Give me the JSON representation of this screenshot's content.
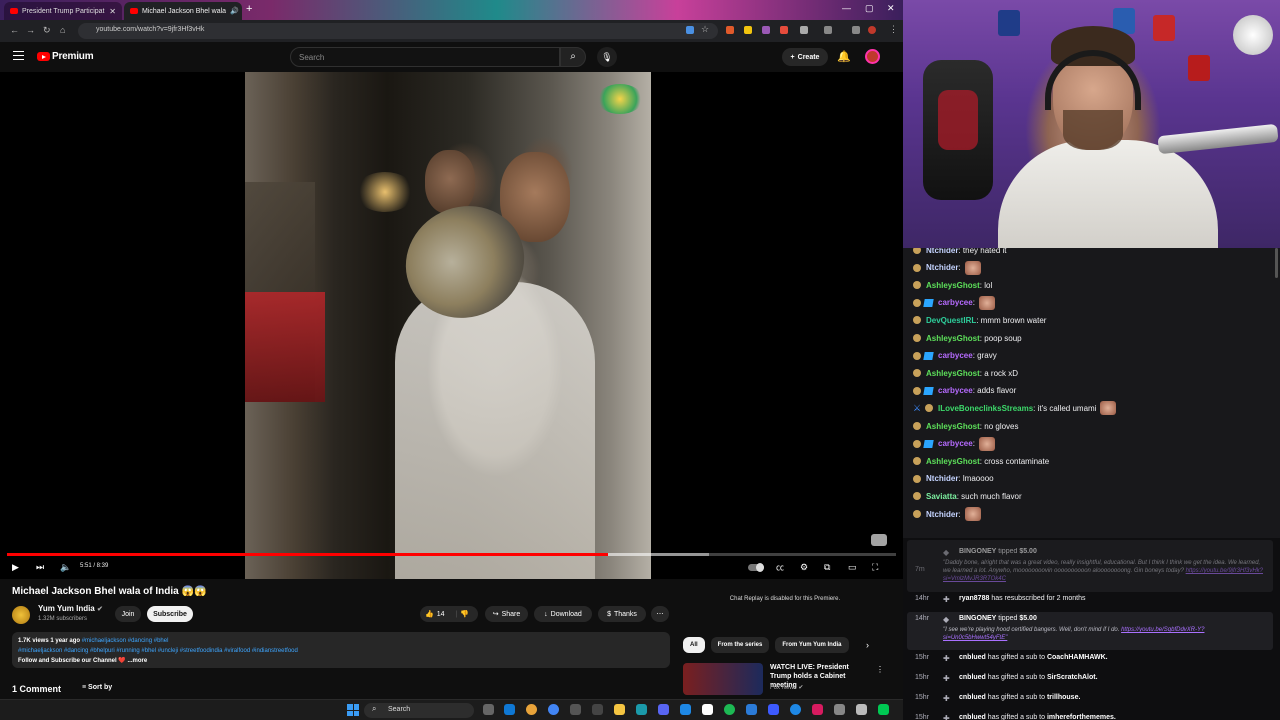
{
  "browser": {
    "tabs": [
      {
        "label": "President Trump Participat",
        "active": false
      },
      {
        "label": "Michael Jackson Bhel wala",
        "active": true
      }
    ],
    "url": "youtube.com/watch?v=9jfr3Hf3vHk"
  },
  "youtube": {
    "brand": "Premium",
    "search_placeholder": "Search",
    "create_label": "Create"
  },
  "player": {
    "time_display": "5:51 / 8:39",
    "progress_fraction": 0.676,
    "buffer_fraction": 0.79
  },
  "video_info": {
    "title": "Michael Jackson Bhel wala of India 😱😱",
    "channel": "Yum Yum India",
    "subscribers": "1.32M subscribers",
    "join_label": "Join",
    "subscribe_label": "Subscribe",
    "like_count": "14",
    "share_label": "Share",
    "download_label": "Download",
    "thanks_label": "Thanks",
    "views_line": "1.7K views  1 year ago",
    "views_tags": "#michaeljackson #dancing #bhel",
    "tags_line": "#michaeljackson #dancing #bhelpuri #running #bhel #uncleji #streetfoodindia #viralfood #indianstreetfood",
    "follow_line": "Follow and Subscribe our Channel ❤️",
    "more_label": "...more",
    "comments_count": "1 Comment",
    "sort_label": "Sort by",
    "chat_replay_note": "Chat Replay is disabled for this Premiere."
  },
  "chips": [
    "All",
    "From the series",
    "From Yum Yum India"
  ],
  "recommended": {
    "title": "WATCH LIVE: President Trump holds a Cabinet meeting",
    "channel": "Fox News"
  },
  "taskbar": {
    "search_label": "Search"
  },
  "chat": {
    "messages": [
      {
        "user": "Ntchider",
        "color": "#c4d3ff",
        "text": ": they hated it",
        "emote": false,
        "badge": "std"
      },
      {
        "user": "Ntchider",
        "color": "#c4d3ff",
        "text": ":",
        "emote": true,
        "badge": "std"
      },
      {
        "user": "AshleysGhost",
        "color": "#5de05a",
        "text": ": lol",
        "emote": false,
        "badge": "std"
      },
      {
        "user": "carbycee",
        "color": "#b66bff",
        "text": ":",
        "emote": true,
        "badge": "sub"
      },
      {
        "user": "DevQuestIRL",
        "color": "#2ecf9c",
        "text": ": mmm brown water",
        "emote": false,
        "badge": "std"
      },
      {
        "user": "AshleysGhost",
        "color": "#5de05a",
        "text": ": poop soup",
        "emote": false,
        "badge": "std"
      },
      {
        "user": "carbycee",
        "color": "#b66bff",
        "text": ": gravy",
        "emote": false,
        "badge": "sub"
      },
      {
        "user": "AshleysGhost",
        "color": "#5de05a",
        "text": ": a rock xD",
        "emote": false,
        "badge": "std"
      },
      {
        "user": "carbycee",
        "color": "#b66bff",
        "text": ": adds flavor",
        "emote": false,
        "badge": "sub"
      },
      {
        "user": "ILoveBoneclinksStreams",
        "color": "#3cd96a",
        "text": ": it's called umami",
        "emote": true,
        "badge": "mod"
      },
      {
        "user": "AshleysGhost",
        "color": "#5de05a",
        "text": ": no gloves",
        "emote": false,
        "badge": "std"
      },
      {
        "user": "carbycee",
        "color": "#b66bff",
        "text": ":",
        "emote": true,
        "badge": "sub"
      },
      {
        "user": "AshleysGhost",
        "color": "#5de05a",
        "text": ": cross contaminate",
        "emote": false,
        "badge": "std"
      },
      {
        "user": "Ntchider",
        "color": "#c4d3ff",
        "text": ": lmaoooo",
        "emote": false,
        "badge": "std"
      },
      {
        "user": "Saviatta",
        "color": "#7cf0a0",
        "text": ": such much flavor",
        "emote": false,
        "badge": "std"
      },
      {
        "user": "Ntchider",
        "color": "#c4d3ff",
        "text": ":",
        "emote": true,
        "badge": "std"
      }
    ]
  },
  "events": {
    "tip1": {
      "time": "7m",
      "user": "BINGONEY",
      "action": "tipped",
      "amount": "$5.00",
      "message": "\"Daddy bone, alright that was a great video, really insightful, educational. But I think I think we get the idea. We learned, we learned a lot. Anywho, moooooooovin oooooooooon aloooooooong. Gin boneys today? ",
      "link": "https://youtu.be/9jfr3Hf3vHk?si=VmlzMvJR3RTOk4C"
    },
    "resub": {
      "time": "14hr",
      "user": "ryan8788",
      "text": "has resubscribed for 2 months"
    },
    "tip2": {
      "time": "14hr",
      "user": "BINGONEY",
      "action": "tipped",
      "amount": "$5.00",
      "message": "\"I see we're playing hood certified bangers. Well, don't mind if I do. ",
      "link": "https://youtu.be/SqbfDdvXR-Y?si=Un0c5bHwwt54yFtE\""
    },
    "gifts": [
      {
        "time": "15hr",
        "user": "cnblued",
        "text": "has gifted a sub to ",
        "target": "CoachHAMHAWK."
      },
      {
        "time": "15hr",
        "user": "cnblued",
        "text": "has gifted a sub to ",
        "target": "SirScratchAlot."
      },
      {
        "time": "15hr",
        "user": "cnblued",
        "text": "has gifted a sub to ",
        "target": "trillhouse."
      },
      {
        "time": "15hr",
        "user": "cnblued",
        "text": "has gifted a sub to ",
        "target": "imhereforthememes."
      }
    ]
  }
}
